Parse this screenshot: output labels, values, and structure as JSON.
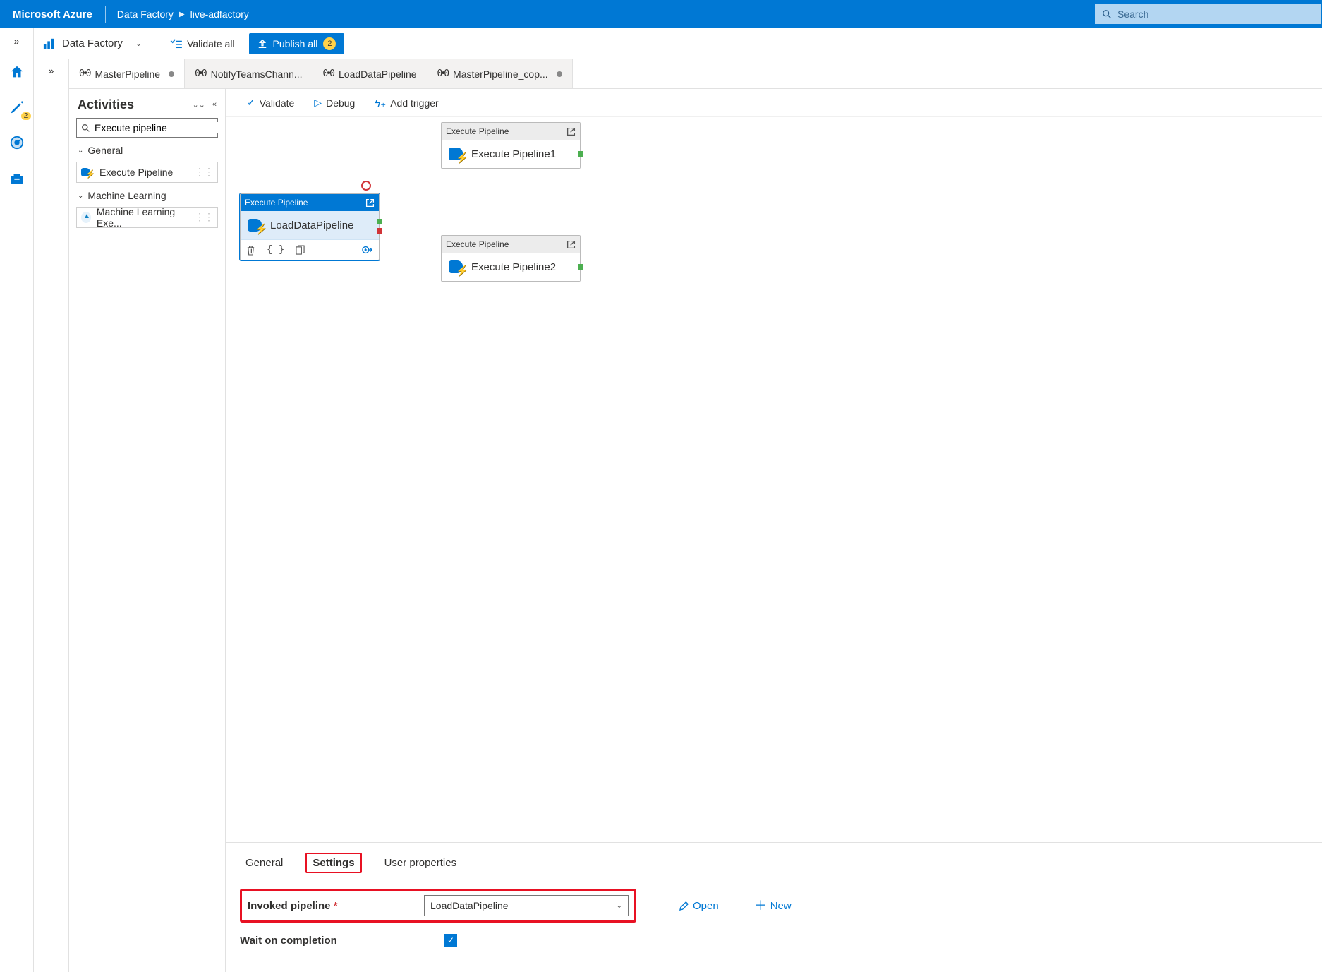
{
  "header": {
    "logo": "Microsoft Azure",
    "breadcrumb_service": "Data Factory",
    "breadcrumb_resource": "live-adfactory",
    "search_placeholder": "Search"
  },
  "left_rail": {
    "expand_glyph": "»",
    "pencil_badge": "2"
  },
  "command_bar": {
    "service_label": "Data Factory",
    "validate_all": "Validate all",
    "publish_all": "Publish all",
    "publish_count": "2",
    "expand_glyph": "»"
  },
  "tabs": [
    {
      "label": "MasterPipeline",
      "dirty": true,
      "active": true
    },
    {
      "label": "NotifyTeamsChann...",
      "dirty": false,
      "active": false
    },
    {
      "label": "LoadDataPipeline",
      "dirty": false,
      "active": false
    },
    {
      "label": "MasterPipeline_cop...",
      "dirty": true,
      "active": false
    }
  ],
  "activities": {
    "title": "Activities",
    "search_value": "Execute pipeline",
    "groups": [
      {
        "name": "General",
        "items": [
          {
            "label": "Execute Pipeline",
            "icon": "exec"
          }
        ]
      },
      {
        "name": "Machine Learning",
        "items": [
          {
            "label": "Machine Learning Exe...",
            "icon": "ml"
          }
        ]
      }
    ]
  },
  "designer_toolbar": {
    "validate": "Validate",
    "debug": "Debug",
    "add_trigger": "Add trigger"
  },
  "canvas": {
    "selected_node": {
      "type_label": "Execute Pipeline",
      "name": "LoadDataPipeline"
    },
    "nodes": [
      {
        "type_label": "Execute Pipeline",
        "name": "Execute Pipeline1"
      },
      {
        "type_label": "Execute Pipeline",
        "name": "Execute Pipeline2"
      }
    ]
  },
  "properties": {
    "tabs": {
      "general": "General",
      "settings": "Settings",
      "user_properties": "User properties"
    },
    "invoked_pipeline_label": "Invoked pipeline",
    "invoked_pipeline_value": "LoadDataPipeline",
    "wait_label": "Wait on completion",
    "open": "Open",
    "new": "New"
  }
}
